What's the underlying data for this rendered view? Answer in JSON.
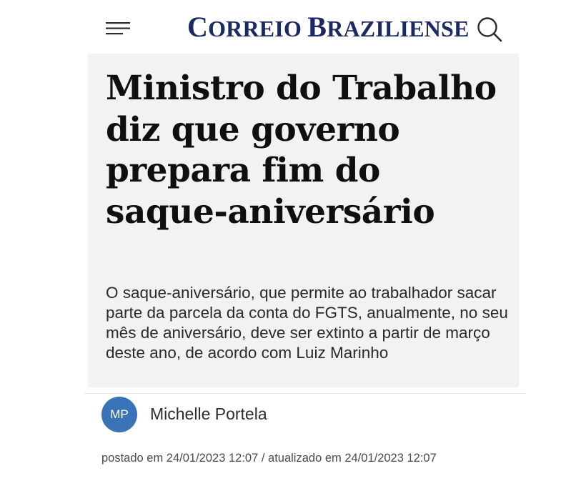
{
  "header": {
    "logo_first_initial": "C",
    "logo_first_rest": "ORREIO",
    "logo_second_initial": "B",
    "logo_second_rest": "RAZILIENSE",
    "menu_icon": "hamburger-menu-icon",
    "search_icon": "search-icon",
    "brand_color": "#1c2a63"
  },
  "article": {
    "headline": "Ministro do Trabalho diz que governo prepara fim do saque-aniversário",
    "subtitle": "O saque-aniversário, que permite ao trabalhador sacar parte da parcela da conta do FGTS, anualmente, no seu mês de aniversário, deve ser extinto a partir de março deste ano, de acordo com Luiz Marinho",
    "background_color": "#f2f2f3"
  },
  "author": {
    "initials": "MP",
    "name": "Michelle Portela",
    "avatar_color": "#3a74b8"
  },
  "meta": {
    "posted": "postado em 24/01/2023 12:07 / atualizado em 24/01/2023 12:07"
  }
}
